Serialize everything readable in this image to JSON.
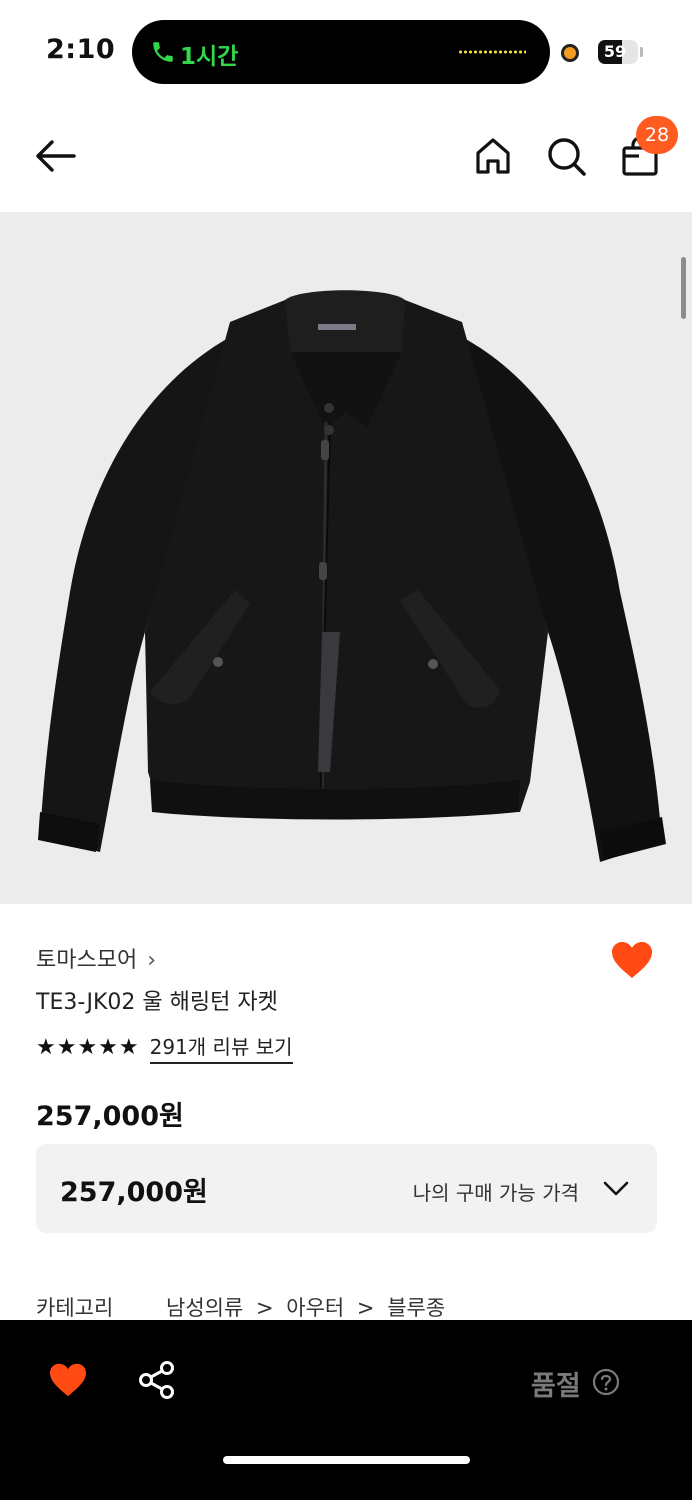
{
  "status": {
    "time": "2:10",
    "call_label": "1시간",
    "battery": "59",
    "battery_level": 0.59
  },
  "header": {
    "cart_count": "28"
  },
  "product": {
    "brand": "토마스모어",
    "brand_chevron": "›",
    "name": "TE3-JK02 울 해링턴 자켓",
    "stars": "★★★★★",
    "review_link": "291개 리뷰 보기",
    "price": "257,000원",
    "my_price": "257,000원",
    "my_price_label": "나의 구매 가능 가격",
    "category_label": "카테고리",
    "category_path": [
      "남성의류",
      "아우터",
      "블루종"
    ],
    "category_sep": ">"
  },
  "bottom": {
    "status_label": "품절"
  },
  "colors": {
    "accent": "#ff4a14",
    "badge": "#ff5a1f",
    "call": "#32d74b"
  },
  "icons": [
    "back-arrow-icon",
    "home-icon",
    "search-icon",
    "shopping-bag-icon",
    "heart-icon",
    "share-icon",
    "help-icon",
    "chevron-down-icon"
  ]
}
